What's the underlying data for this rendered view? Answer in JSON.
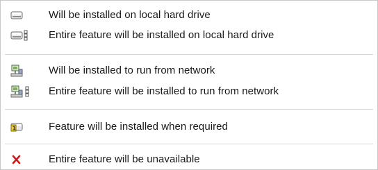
{
  "menu": {
    "items": [
      {
        "icon": "hard-drive-icon",
        "label": "Will be installed on local hard drive"
      },
      {
        "icon": "hard-drive-entire-icon",
        "label": "Entire feature will be installed on local hard drive"
      },
      {
        "icon": "network-icon",
        "label": "Will be installed to run from network"
      },
      {
        "icon": "network-entire-icon",
        "label": "Entire feature will be installed to run from network"
      },
      {
        "icon": "install-on-demand-icon",
        "label": "Feature will be installed when required"
      },
      {
        "icon": "unavailable-x-icon",
        "label": "Entire feature will be unavailable"
      }
    ]
  },
  "colors": {
    "drive_gray": "#9a9a9a",
    "network_green": "#4a8a3a",
    "demand_yellow": "#f2d23a",
    "unavailable_red": "#cc1a1a"
  }
}
